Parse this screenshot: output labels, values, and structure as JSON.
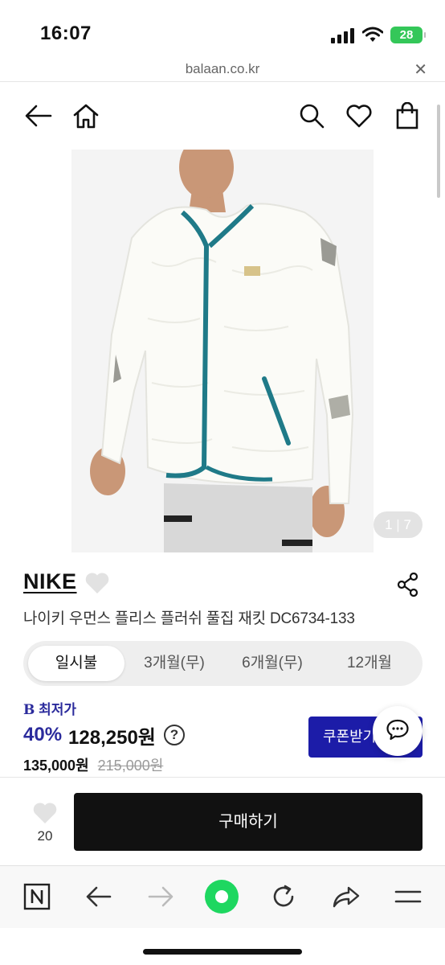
{
  "status_bar": {
    "time": "16:07",
    "battery": "28"
  },
  "browser": {
    "url": "balaan.co.kr",
    "close_label": "✕"
  },
  "header": {
    "back_icon": "back-arrow-icon",
    "home_icon": "home-icon",
    "search_icon": "search-icon",
    "wishlist_icon": "heart-icon",
    "cart_icon": "shopping-bag-icon"
  },
  "product": {
    "image_counter_current": "1",
    "image_counter_total": "7",
    "brand": "NIKE",
    "name": "나이키 우먼스 플리스 플러쉬 풀집 재킷 DC6734-133"
  },
  "payment_tabs": [
    {
      "label": "일시불",
      "active": true
    },
    {
      "label": "3개월(무)",
      "active": false
    },
    {
      "label": "6개월(무)",
      "active": false
    },
    {
      "label": "12개월",
      "active": false
    }
  ],
  "pricing": {
    "lowest_label": "최저가",
    "lowest_prefix": "B",
    "discount": "40%",
    "final_price": "128,250원",
    "help": "?",
    "sale_price": "135,000원",
    "original_price": "215,000원",
    "coupon_button": "쿠폰받기"
  },
  "bottom_bar": {
    "wish_count": "20",
    "buy_button": "구매하기"
  },
  "colors": {
    "accent": "#1c1ca8",
    "buy_button": "#111111",
    "battery": "#34c759",
    "naver_green": "#1ed760"
  }
}
